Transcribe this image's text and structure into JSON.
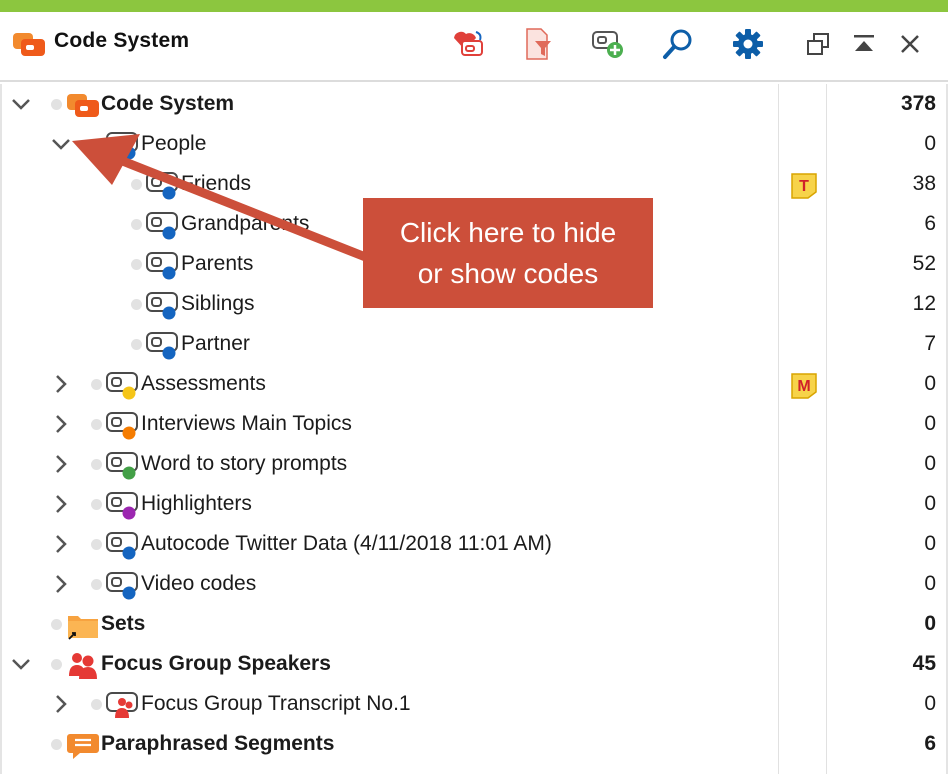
{
  "window": {
    "title": "Code System",
    "toolbar": [
      {
        "name": "reset-activations-icon",
        "color": "#e0403a"
      },
      {
        "name": "filter-icon",
        "color": "#e06a5a"
      },
      {
        "name": "new-code-icon",
        "color": "#4caf50"
      },
      {
        "name": "search-icon",
        "color": "#0d5ea8"
      },
      {
        "name": "settings-icon",
        "color": "#0d5ea8"
      },
      {
        "name": "undock-icon",
        "color": "#444444"
      },
      {
        "name": "maximize-icon",
        "color": "#444444"
      },
      {
        "name": "close-icon",
        "color": "#444444"
      }
    ]
  },
  "colors": {
    "accent_strip": "#8cc63f",
    "callout": "#cc4f3a",
    "memo_badge": "#f7d34a"
  },
  "tree": [
    {
      "label": "Code System",
      "count": "378",
      "bold": true,
      "icon": "code-system-icon",
      "expanded": true,
      "level": 0
    },
    {
      "label": "People",
      "count": "0",
      "icon": "code-tag-icon",
      "color": "#1565c0",
      "expanded": true,
      "level": 1
    },
    {
      "label": "Friends",
      "count": "38",
      "icon": "code-tag-icon",
      "color": "#1565c0",
      "level": 2,
      "memo": "T"
    },
    {
      "label": "Grandparents",
      "count": "6",
      "icon": "code-tag-icon",
      "color": "#1565c0",
      "level": 2
    },
    {
      "label": "Parents",
      "count": "52",
      "icon": "code-tag-icon",
      "color": "#1565c0",
      "level": 2
    },
    {
      "label": "Siblings",
      "count": "12",
      "icon": "code-tag-icon",
      "color": "#1565c0",
      "level": 2
    },
    {
      "label": "Partner",
      "count": "7",
      "icon": "code-tag-icon",
      "color": "#1565c0",
      "level": 2
    },
    {
      "label": "Assessments",
      "count": "0",
      "icon": "code-tag-icon",
      "color": "#f5c518",
      "expanded": false,
      "level": 1,
      "memo": "M"
    },
    {
      "label": "Interviews Main Topics",
      "count": "0",
      "icon": "code-tag-icon",
      "color": "#f57c00",
      "expanded": false,
      "level": 1
    },
    {
      "label": "Word to story prompts",
      "count": "0",
      "icon": "code-tag-icon",
      "color": "#43a047",
      "expanded": false,
      "level": 1
    },
    {
      "label": "Highlighters",
      "count": "0",
      "icon": "code-tag-icon",
      "color": "#9c27b0",
      "expanded": false,
      "level": 1
    },
    {
      "label": "Autocode Twitter Data (4/11/2018 11:01 AM)",
      "count": "0",
      "icon": "code-tag-icon",
      "color": "#1565c0",
      "expanded": false,
      "level": 1
    },
    {
      "label": "Video codes",
      "count": "0",
      "icon": "code-tag-icon",
      "color": "#1565c0",
      "expanded": false,
      "level": 1
    },
    {
      "label": "Sets",
      "count": "0",
      "bold": true,
      "icon": "sets-folder-icon",
      "level": 0
    },
    {
      "label": "Focus Group Speakers",
      "count": "45",
      "bold": true,
      "icon": "speakers-icon",
      "expanded": true,
      "level": 0
    },
    {
      "label": "Focus Group Transcript No.1",
      "count": "0",
      "icon": "speaker-code-icon",
      "expanded": false,
      "level": 1
    },
    {
      "label": "Paraphrased Segments",
      "count": "6",
      "bold": true,
      "icon": "paraphrase-icon",
      "level": 0
    }
  ],
  "callout": {
    "line1": "Click here to hide",
    "line2": "or show codes"
  }
}
